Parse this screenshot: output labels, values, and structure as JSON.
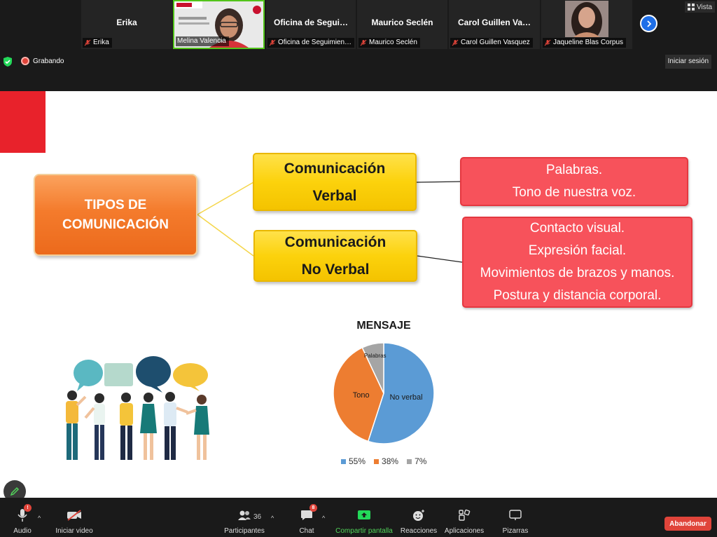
{
  "participants": [
    {
      "display": "Erika",
      "label": "Erika",
      "type": "name"
    },
    {
      "display": "",
      "label": "Melina Valencia",
      "type": "video"
    },
    {
      "display": "Oficina  de  Segui…",
      "label": "Oficina de Seguimien…",
      "type": "name"
    },
    {
      "display": "Maurico Seclén",
      "label": "Maurico Seclén",
      "type": "name"
    },
    {
      "display": "Carol  Guillen  Va…",
      "label": "Carol Guillen Vasquez",
      "type": "name"
    },
    {
      "display": "",
      "label": "Jaqueline Blas Corpus",
      "type": "photo"
    }
  ],
  "view_label": "Vista",
  "recording_label": "Grabando",
  "signin_label": "Iniciar sesión",
  "slide": {
    "main_box": [
      "TIPOS DE",
      "COMUNICACIÓN"
    ],
    "verbal_box": [
      "Comunicación",
      "Verbal"
    ],
    "noverbal_box": [
      "Comunicación",
      "No Verbal"
    ],
    "verbal_items": [
      "Palabras.",
      "Tono de nuestra voz."
    ],
    "noverbal_items": [
      "Contacto visual.",
      "Expresión facial.",
      "Movimientos de brazos y manos.",
      "Postura y distancia corporal."
    ]
  },
  "chart_data": {
    "type": "pie",
    "title": "MENSAJE",
    "slices": [
      {
        "label": "No verbal",
        "value": 55,
        "color": "#5b9bd5"
      },
      {
        "label": "Tono",
        "value": 38,
        "color": "#ed7d31"
      },
      {
        "label": "Palabras",
        "value": 7,
        "color": "#a5a5a5"
      }
    ],
    "legend": [
      "55%",
      "38%",
      "7%"
    ],
    "legend_placement": "bottom"
  },
  "toolbar": {
    "audio": "Audio",
    "audio_badge": "!",
    "video": "Iniciar video",
    "participants": "Participantes",
    "participants_count": "36",
    "chat": "Chat",
    "chat_badge": "8",
    "share": "Compartir pantalla",
    "reactions": "Reacciones",
    "apps": "Aplicaciones",
    "whiteboards": "Pizarras",
    "leave": "Abandonar"
  }
}
